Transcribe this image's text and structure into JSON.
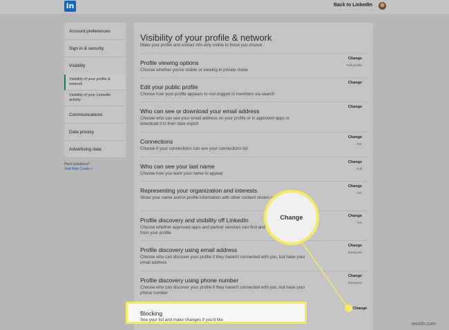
{
  "header": {
    "logo_text": "in",
    "back_link": "Back to LinkedIn"
  },
  "sidebar": {
    "items": [
      {
        "label": "Account preferences"
      },
      {
        "label": "Sign in & security"
      },
      {
        "label": "Visibility"
      },
      {
        "label": "Communications"
      },
      {
        "label": "Data privacy"
      },
      {
        "label": "Advertising data"
      }
    ],
    "subitems": [
      {
        "label": "Visibility of your profile & network",
        "active": true
      },
      {
        "label": "Visibility of your LinkedIn activity",
        "active": false
      }
    ],
    "help_question": "Have questions?",
    "help_link": "Visit Help Center"
  },
  "main": {
    "title": "Visibility of your profile & network",
    "subtitle": "Make your profile and contact info only visible to those you choose",
    "rows": [
      {
        "title": "Profile viewing options",
        "desc": "Choose whether you're visible or viewing in private mode",
        "change": "Change",
        "value": "Full profile"
      },
      {
        "title": "Edit your public profile",
        "desc": "Choose how your profile appears to non-logged in members via search",
        "change": "Change",
        "value": ""
      },
      {
        "title": "Who can see or download your email address",
        "desc": "Choose who can see your email address on your profile or in approved apps or download it in their data export",
        "change": "Change",
        "value": ""
      },
      {
        "title": "Connections",
        "desc": "Choose if your connections can see your connections list",
        "change": "Change",
        "value": "Yes"
      },
      {
        "title": "Who can see your last name",
        "desc": "Choose how you want your name to appear",
        "change": "Change",
        "value": "Full"
      },
      {
        "title": "Representing your organization and interests",
        "desc": "Show your name and/or profile information with other content shown on LinkedIn?",
        "change": "Change",
        "value": "Yes"
      },
      {
        "title": "Profile discovery and visibility off LinkedIn",
        "desc": "Choose whether approved apps and partner services can find and display information from your profile",
        "change": "Change",
        "value": "Yes"
      },
      {
        "title": "Profile discovery using email address",
        "desc": "Choose who can discover your profile if they haven't connected with you, but have your email address",
        "change": "Change",
        "value": "Everyone"
      },
      {
        "title": "Profile discovery using phone number",
        "desc": "Choose who can discover your profile if they haven't connected with you, but have your phone number",
        "change": "Change",
        "value": "Everyone"
      }
    ]
  },
  "callout": {
    "magnified_label": "Change",
    "blocking_title": "Blocking",
    "blocking_desc": "See your list and make changes if you'd like",
    "blocking_change": "Change",
    "highlight_color": "#f4ea63"
  },
  "watermark": "wsxdn.com"
}
